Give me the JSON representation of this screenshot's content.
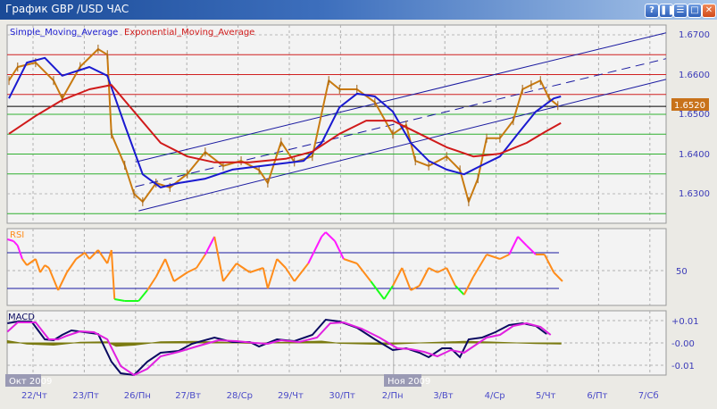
{
  "window": {
    "title": "График GBP /USD  ЧАС",
    "buttons": [
      "?",
      "pause",
      "minimize",
      "maximize",
      "close"
    ],
    "button_glyphs": [
      "?",
      "❚❚",
      "☰",
      "□",
      "✕"
    ]
  },
  "main_panel": {
    "legend": [
      "Simple_Moving_Average",
      "Exponential_Moving_Average"
    ],
    "legend_colors": [
      "#1a1ad0",
      "#d01a1a"
    ],
    "y_ticks": [
      "1.6700",
      "1.6600",
      "1.6500",
      "1.6400",
      "1.6300"
    ],
    "current_price": "1.6520"
  },
  "rsi_panel": {
    "label": "RSI",
    "y_ticks": [
      "50"
    ]
  },
  "macd_panel": {
    "label": "MACD",
    "y_ticks": [
      "+0.01",
      "-0.00",
      "-0.01"
    ]
  },
  "x_axis": {
    "month_labels": [
      "Окт 2009",
      "Ноя 2009"
    ],
    "date_labels": [
      "22/Чт",
      "23/Пт",
      "26/Пн",
      "27/Вт",
      "28/Ср",
      "29/Чт",
      "30/Пт",
      "2/Пн",
      "3/Вт",
      "4/Ср",
      "5/Чт",
      "6/Пт",
      "7/Сб"
    ]
  },
  "chart_data": [
    {
      "type": "line",
      "title": "GBP /USD",
      "x_unit": "trading day index (0 = 22/Чт)",
      "ylim": [
        1.625,
        1.672
      ],
      "horizontal_levels": {
        "red": [
          1.665,
          1.66,
          1.655
        ],
        "black": [
          1.652
        ],
        "green": [
          1.65,
          1.645,
          1.64,
          1.635,
          1.625
        ]
      },
      "trendlines": [
        {
          "style": "solid",
          "from": [
            2.0,
            1.638
          ],
          "to": [
            12.35,
            1.6705
          ]
        },
        {
          "style": "dashed",
          "from": [
            2.0,
            1.6318
          ],
          "to": [
            12.35,
            1.664
          ]
        },
        {
          "style": "solid",
          "from": [
            2.06,
            1.6257
          ],
          "to": [
            12.35,
            1.6588
          ]
        }
      ],
      "series": [
        {
          "name": "price",
          "color": "#c87a10",
          "points": [
            [
              -0.47,
              1.6585
            ],
            [
              -0.3,
              1.6619
            ],
            [
              0.05,
              1.663
            ],
            [
              0.4,
              1.6585
            ],
            [
              0.57,
              1.654
            ],
            [
              0.92,
              1.662
            ],
            [
              1.27,
              1.6664
            ],
            [
              1.45,
              1.665
            ],
            [
              1.53,
              1.645
            ],
            [
              1.79,
              1.6372
            ],
            [
              1.97,
              1.63
            ],
            [
              2.14,
              1.628
            ],
            [
              2.4,
              1.6327
            ],
            [
              2.67,
              1.6316
            ],
            [
              3.01,
              1.635
            ],
            [
              3.36,
              1.6405
            ],
            [
              3.71,
              1.637
            ],
            [
              4.06,
              1.6383
            ],
            [
              4.41,
              1.636
            ],
            [
              4.58,
              1.6327
            ],
            [
              4.84,
              1.643
            ],
            [
              5.1,
              1.638
            ],
            [
              5.45,
              1.6394
            ],
            [
              5.77,
              1.6585
            ],
            [
              5.98,
              1.6563
            ],
            [
              6.32,
              1.6563
            ],
            [
              6.67,
              1.653
            ],
            [
              7.02,
              1.645
            ],
            [
              7.28,
              1.6473
            ],
            [
              7.46,
              1.6383
            ],
            [
              7.72,
              1.637
            ],
            [
              8.07,
              1.6394
            ],
            [
              8.33,
              1.636
            ],
            [
              8.5,
              1.628
            ],
            [
              8.68,
              1.6338
            ],
            [
              8.85,
              1.644
            ],
            [
              9.11,
              1.644
            ],
            [
              9.37,
              1.6484
            ],
            [
              9.55,
              1.6563
            ],
            [
              9.72,
              1.6574
            ],
            [
              9.9,
              1.6585
            ],
            [
              10.07,
              1.654
            ],
            [
              10.24,
              1.6522
            ]
          ]
        },
        {
          "name": "Simple_Moving_Average",
          "color": "#1a1ad0",
          "points": [
            [
              -0.47,
              1.654
            ],
            [
              -0.12,
              1.663
            ],
            [
              0.23,
              1.6642
            ],
            [
              0.57,
              1.6597
            ],
            [
              1.1,
              1.6619
            ],
            [
              1.45,
              1.6597
            ],
            [
              1.79,
              1.6473
            ],
            [
              2.14,
              1.6349
            ],
            [
              2.49,
              1.6316
            ],
            [
              2.84,
              1.6327
            ],
            [
              3.36,
              1.6338
            ],
            [
              3.89,
              1.6361
            ],
            [
              4.58,
              1.6372
            ],
            [
              5.28,
              1.6383
            ],
            [
              5.63,
              1.6428
            ],
            [
              5.98,
              1.6518
            ],
            [
              6.32,
              1.6552
            ],
            [
              6.67,
              1.6545
            ],
            [
              7.02,
              1.6507
            ],
            [
              7.37,
              1.6428
            ],
            [
              7.72,
              1.6383
            ],
            [
              8.07,
              1.6361
            ],
            [
              8.41,
              1.6349
            ],
            [
              8.76,
              1.6372
            ],
            [
              9.11,
              1.6394
            ],
            [
              9.46,
              1.6451
            ],
            [
              9.81,
              1.6507
            ],
            [
              10.16,
              1.654
            ],
            [
              10.3,
              1.6545
            ]
          ]
        },
        {
          "name": "Exponential_Moving_Average",
          "color": "#d01a1a",
          "points": [
            [
              -0.47,
              1.6451
            ],
            [
              0.05,
              1.6496
            ],
            [
              0.57,
              1.6536
            ],
            [
              1.1,
              1.6563
            ],
            [
              1.53,
              1.6574
            ],
            [
              1.97,
              1.6507
            ],
            [
              2.49,
              1.6428
            ],
            [
              3.01,
              1.6394
            ],
            [
              3.54,
              1.6379
            ],
            [
              4.23,
              1.6379
            ],
            [
              4.93,
              1.6388
            ],
            [
              5.45,
              1.6406
            ],
            [
              5.98,
              1.6451
            ],
            [
              6.5,
              1.6484
            ],
            [
              7.02,
              1.6484
            ],
            [
              7.54,
              1.6451
            ],
            [
              8.07,
              1.6417
            ],
            [
              8.59,
              1.6394
            ],
            [
              9.11,
              1.6401
            ],
            [
              9.63,
              1.6428
            ],
            [
              9.98,
              1.6455
            ],
            [
              10.3,
              1.6478
            ]
          ]
        }
      ]
    },
    {
      "type": "line",
      "title": "RSI",
      "levels": [
        70,
        50,
        30
      ],
      "ylim": [
        15,
        97
      ],
      "colors": {
        "overbought": "#ff1aff",
        "normal": "#ff8c1a",
        "oversold": "#1aff1a"
      },
      "points": [
        [
          -0.5,
          85
        ],
        [
          -0.38,
          83
        ],
        [
          -0.3,
          78
        ],
        [
          -0.21,
          63
        ],
        [
          -0.12,
          56
        ],
        [
          0.05,
          63
        ],
        [
          0.14,
          48
        ],
        [
          0.23,
          56
        ],
        [
          0.31,
          53
        ],
        [
          0.49,
          28
        ],
        [
          0.66,
          48
        ],
        [
          0.84,
          63
        ],
        [
          1.01,
          70
        ],
        [
          1.1,
          63
        ],
        [
          1.27,
          73
        ],
        [
          1.45,
          58
        ],
        [
          1.53,
          73
        ],
        [
          1.59,
          18
        ],
        [
          1.79,
          16
        ],
        [
          2.06,
          16
        ],
        [
          2.23,
          28
        ],
        [
          2.4,
          43
        ],
        [
          2.58,
          63
        ],
        [
          2.75,
          38
        ],
        [
          3.01,
          48
        ],
        [
          3.19,
          53
        ],
        [
          3.36,
          68
        ],
        [
          3.54,
          88
        ],
        [
          3.71,
          38
        ],
        [
          3.97,
          58
        ],
        [
          4.23,
          48
        ],
        [
          4.49,
          53
        ],
        [
          4.58,
          30
        ],
        [
          4.76,
          63
        ],
        [
          4.93,
          53
        ],
        [
          5.1,
          38
        ],
        [
          5.37,
          58
        ],
        [
          5.63,
          88
        ],
        [
          5.71,
          93
        ],
        [
          5.89,
          83
        ],
        [
          6.06,
          63
        ],
        [
          6.32,
          58
        ],
        [
          6.59,
          38
        ],
        [
          6.85,
          18
        ],
        [
          7.02,
          33
        ],
        [
          7.2,
          53
        ],
        [
          7.37,
          28
        ],
        [
          7.54,
          33
        ],
        [
          7.72,
          53
        ],
        [
          7.89,
          48
        ],
        [
          8.07,
          53
        ],
        [
          8.24,
          33
        ],
        [
          8.41,
          23
        ],
        [
          8.59,
          43
        ],
        [
          8.85,
          68
        ],
        [
          9.11,
          63
        ],
        [
          9.29,
          68
        ],
        [
          9.46,
          88
        ],
        [
          9.63,
          78
        ],
        [
          9.81,
          68
        ],
        [
          9.98,
          68
        ],
        [
          10.16,
          48
        ],
        [
          10.33,
          38
        ]
      ]
    },
    {
      "type": "line",
      "title": "MACD",
      "ylim": [
        -0.016,
        0.013
      ],
      "series": [
        {
          "name": "macd",
          "color": "#0a0a60",
          "points": [
            [
              -0.5,
              0.0088
            ],
            [
              -0.3,
              0.0096
            ],
            [
              -0.03,
              0.0096
            ],
            [
              0.23,
              0.0016
            ],
            [
              0.4,
              0.0012
            ],
            [
              0.57,
              0.0036
            ],
            [
              0.75,
              0.0056
            ],
            [
              1.01,
              0.0048
            ],
            [
              1.27,
              0.004
            ],
            [
              1.53,
              -0.0084
            ],
            [
              1.71,
              -0.0136
            ],
            [
              1.97,
              -0.0144
            ],
            [
              2.23,
              -0.0084
            ],
            [
              2.49,
              -0.0044
            ],
            [
              2.84,
              -0.0036
            ],
            [
              3.1,
              -0.0004
            ],
            [
              3.54,
              0.0024
            ],
            [
              3.89,
              0.0004
            ],
            [
              4.23,
              0.0004
            ],
            [
              4.41,
              -0.0016
            ],
            [
              4.76,
              0.0016
            ],
            [
              5.1,
              0.0008
            ],
            [
              5.45,
              0.0036
            ],
            [
              5.71,
              0.0104
            ],
            [
              5.98,
              0.0096
            ],
            [
              6.32,
              0.0068
            ],
            [
              6.67,
              0.0016
            ],
            [
              7.02,
              -0.0032
            ],
            [
              7.28,
              -0.0024
            ],
            [
              7.54,
              -0.0044
            ],
            [
              7.72,
              -0.0064
            ],
            [
              7.98,
              -0.0024
            ],
            [
              8.15,
              -0.0024
            ],
            [
              8.33,
              -0.0064
            ],
            [
              8.5,
              0.0016
            ],
            [
              8.76,
              0.0024
            ],
            [
              9.02,
              0.0048
            ],
            [
              9.29,
              0.008
            ],
            [
              9.55,
              0.0088
            ],
            [
              9.81,
              0.0076
            ],
            [
              10.02,
              0.004
            ]
          ]
        },
        {
          "name": "signal",
          "color": "#e020e0",
          "points": [
            [
              -0.5,
              0.005
            ],
            [
              -0.3,
              0.0092
            ],
            [
              0.05,
              0.0092
            ],
            [
              0.31,
              0.0016
            ],
            [
              0.49,
              0.0016
            ],
            [
              0.66,
              0.0032
            ],
            [
              0.92,
              0.0052
            ],
            [
              1.19,
              0.0048
            ],
            [
              1.45,
              0.0016
            ],
            [
              1.71,
              -0.0104
            ],
            [
              1.97,
              -0.0144
            ],
            [
              2.23,
              -0.0116
            ],
            [
              2.49,
              -0.006
            ],
            [
              2.84,
              -0.004
            ],
            [
              3.19,
              -0.0016
            ],
            [
              3.62,
              0.0012
            ],
            [
              3.97,
              0.0008
            ],
            [
              4.32,
              0.0
            ],
            [
              4.58,
              -0.0004
            ],
            [
              4.84,
              0.0012
            ],
            [
              5.19,
              0.0004
            ],
            [
              5.54,
              0.0024
            ],
            [
              5.8,
              0.0088
            ],
            [
              6.06,
              0.0092
            ],
            [
              6.41,
              0.0064
            ],
            [
              6.76,
              0.0024
            ],
            [
              7.11,
              -0.0024
            ],
            [
              7.37,
              -0.0028
            ],
            [
              7.63,
              -0.004
            ],
            [
              7.89,
              -0.006
            ],
            [
              8.15,
              -0.0032
            ],
            [
              8.41,
              -0.0044
            ],
            [
              8.59,
              -0.0016
            ],
            [
              8.85,
              0.0024
            ],
            [
              9.11,
              0.0036
            ],
            [
              9.37,
              0.0076
            ],
            [
              9.63,
              0.0088
            ],
            [
              9.9,
              0.0072
            ],
            [
              10.1,
              0.0036
            ]
          ]
        },
        {
          "name": "histogram",
          "color": "#7a7a10",
          "points": [
            [
              -0.5,
              0.001
            ],
            [
              -0.12,
              -0.0005
            ],
            [
              0.4,
              -0.001
            ],
            [
              0.92,
              0.0003
            ],
            [
              1.45,
              0.0005
            ],
            [
              1.62,
              -0.0015
            ],
            [
              1.97,
              -0.001
            ],
            [
              2.49,
              0.0005
            ],
            [
              3.19,
              0.0007
            ],
            [
              3.71,
              0.0003
            ],
            [
              4.23,
              -0.0002
            ],
            [
              4.93,
              0.0003
            ],
            [
              5.63,
              0.0008
            ],
            [
              5.98,
              -0.0002
            ],
            [
              6.85,
              -0.0007
            ],
            [
              7.54,
              0.0
            ],
            [
              8.41,
              0.0007
            ],
            [
              8.94,
              0.0004
            ],
            [
              9.81,
              -0.0003
            ],
            [
              10.3,
              -0.0005
            ]
          ]
        }
      ]
    }
  ]
}
